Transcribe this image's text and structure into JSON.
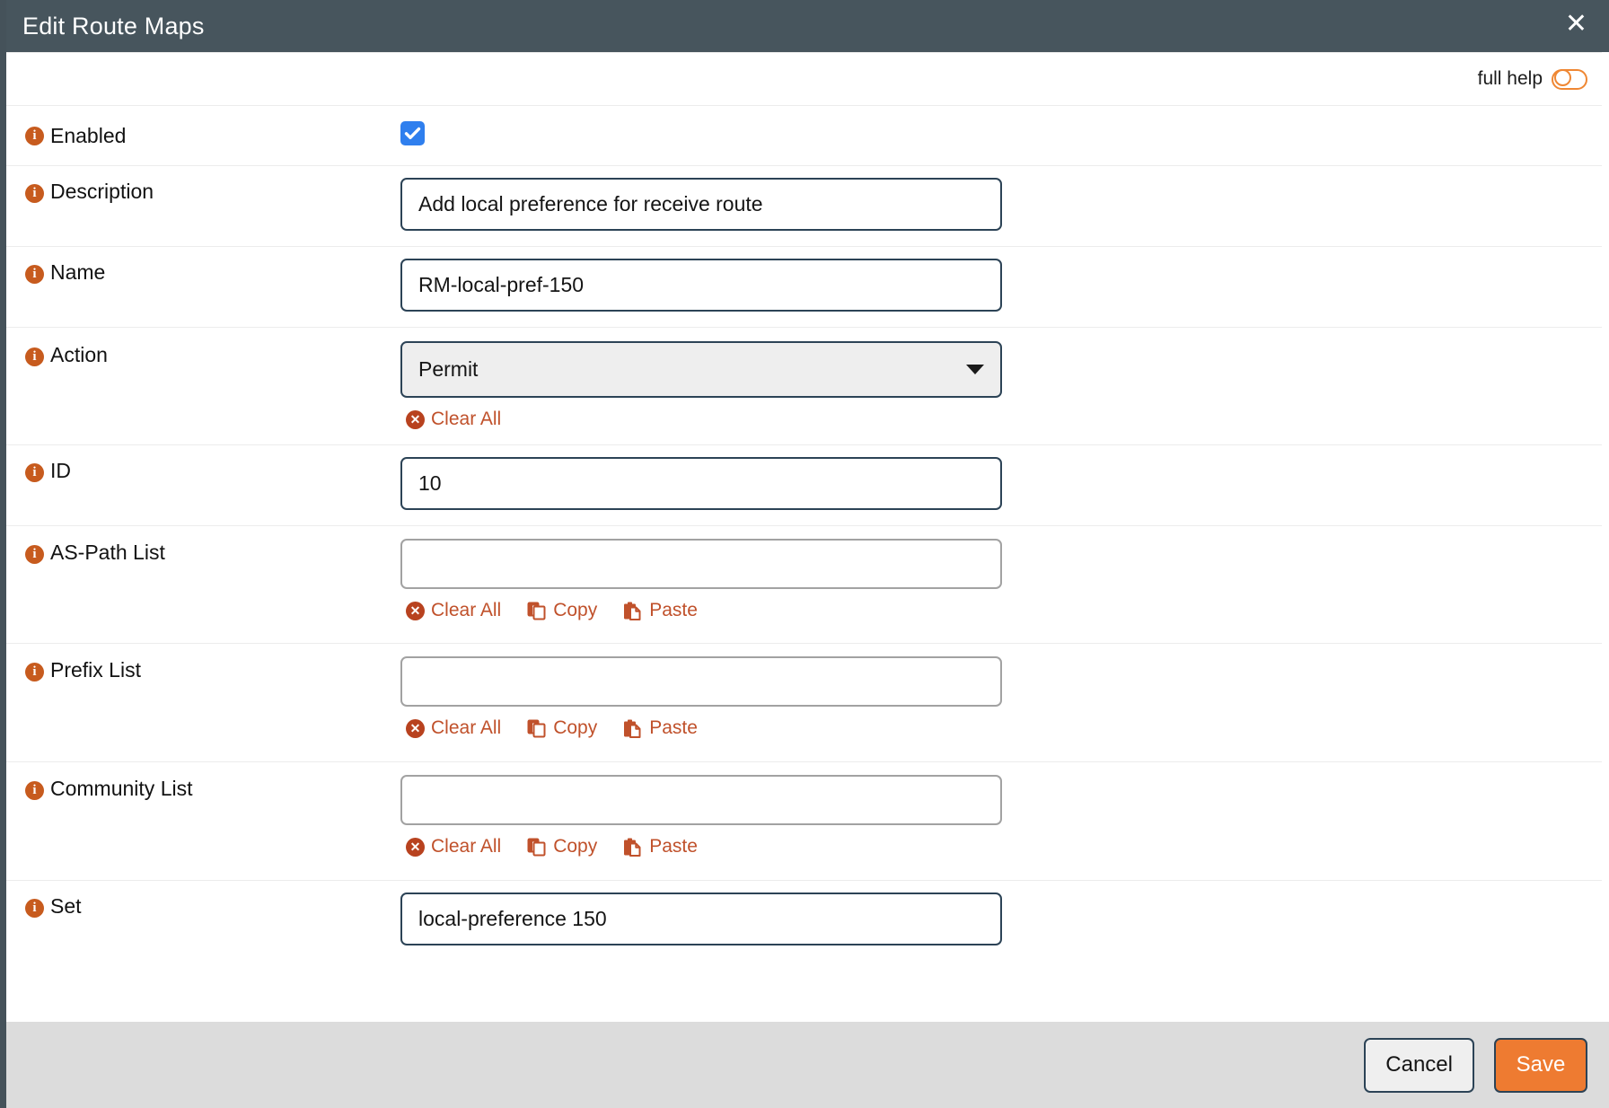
{
  "dialog": {
    "title": "Edit Route Maps",
    "close_icon": "close-icon"
  },
  "help": {
    "label": "full help",
    "toggle_state": "off"
  },
  "colors": {
    "titlebar": "#47555d",
    "accent_orange": "#ee7b31",
    "link_red": "#c0512b",
    "info_icon": "#c75b1e",
    "checkbox_blue": "#2f7fee",
    "input_border": "#2c4356",
    "empty_input_border": "#a2a2a2",
    "footer_bg": "#dcdcdc"
  },
  "form": {
    "rows": [
      {
        "label": "Enabled",
        "type": "checkbox",
        "checked": true
      },
      {
        "label": "Description",
        "type": "text",
        "value": "Add local preference for receive route"
      },
      {
        "label": "Name",
        "type": "text",
        "value": "RM-local-pref-150"
      },
      {
        "label": "Action",
        "type": "select",
        "value": "Permit",
        "actions": [
          "Clear All"
        ]
      },
      {
        "label": "ID",
        "type": "text",
        "value": "10"
      },
      {
        "label": "AS-Path List",
        "type": "text-empty",
        "value": "",
        "actions": [
          "Clear All",
          "Copy",
          "Paste"
        ]
      },
      {
        "label": "Prefix List",
        "type": "text-empty",
        "value": "",
        "actions": [
          "Clear All",
          "Copy",
          "Paste"
        ]
      },
      {
        "label": "Community List",
        "type": "text-empty",
        "value": "",
        "actions": [
          "Clear All",
          "Copy",
          "Paste"
        ]
      },
      {
        "label": "Set",
        "type": "text",
        "value": "local-preference 150"
      }
    ],
    "action_labels": {
      "clear_all": "Clear All",
      "copy": "Copy",
      "paste": "Paste"
    }
  },
  "footer": {
    "cancel_label": "Cancel",
    "save_label": "Save"
  }
}
